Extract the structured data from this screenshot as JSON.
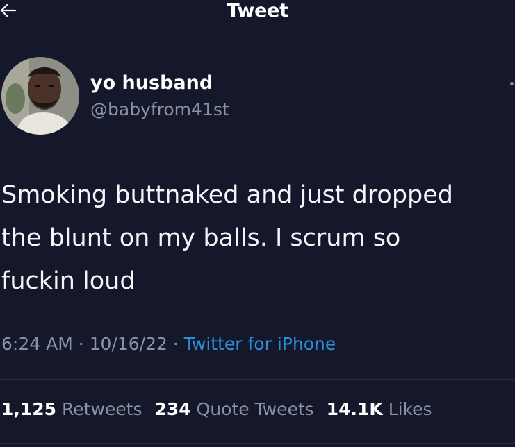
{
  "header": {
    "title": "Tweet",
    "back_icon": "arrow-left-icon"
  },
  "author": {
    "display_name": "yo husband",
    "handle": "@babyfrom41st"
  },
  "tweet": {
    "text": "Smoking buttnaked and just dropped\nthe blunt on my balls. I scrum so\nfuckin loud",
    "time": "6:24 AM",
    "date": "10/16/22",
    "separator": "·",
    "source": "Twitter for iPhone"
  },
  "stats": [
    {
      "count": "1,125",
      "label": "Retweets"
    },
    {
      "count": "234",
      "label": "Quote Tweets"
    },
    {
      "count": "14.1K",
      "label": "Likes"
    }
  ],
  "colors": {
    "background": "#15182a",
    "muted_text": "#8a93a6",
    "link": "#2a8fd8",
    "divider": "#2c3142"
  }
}
